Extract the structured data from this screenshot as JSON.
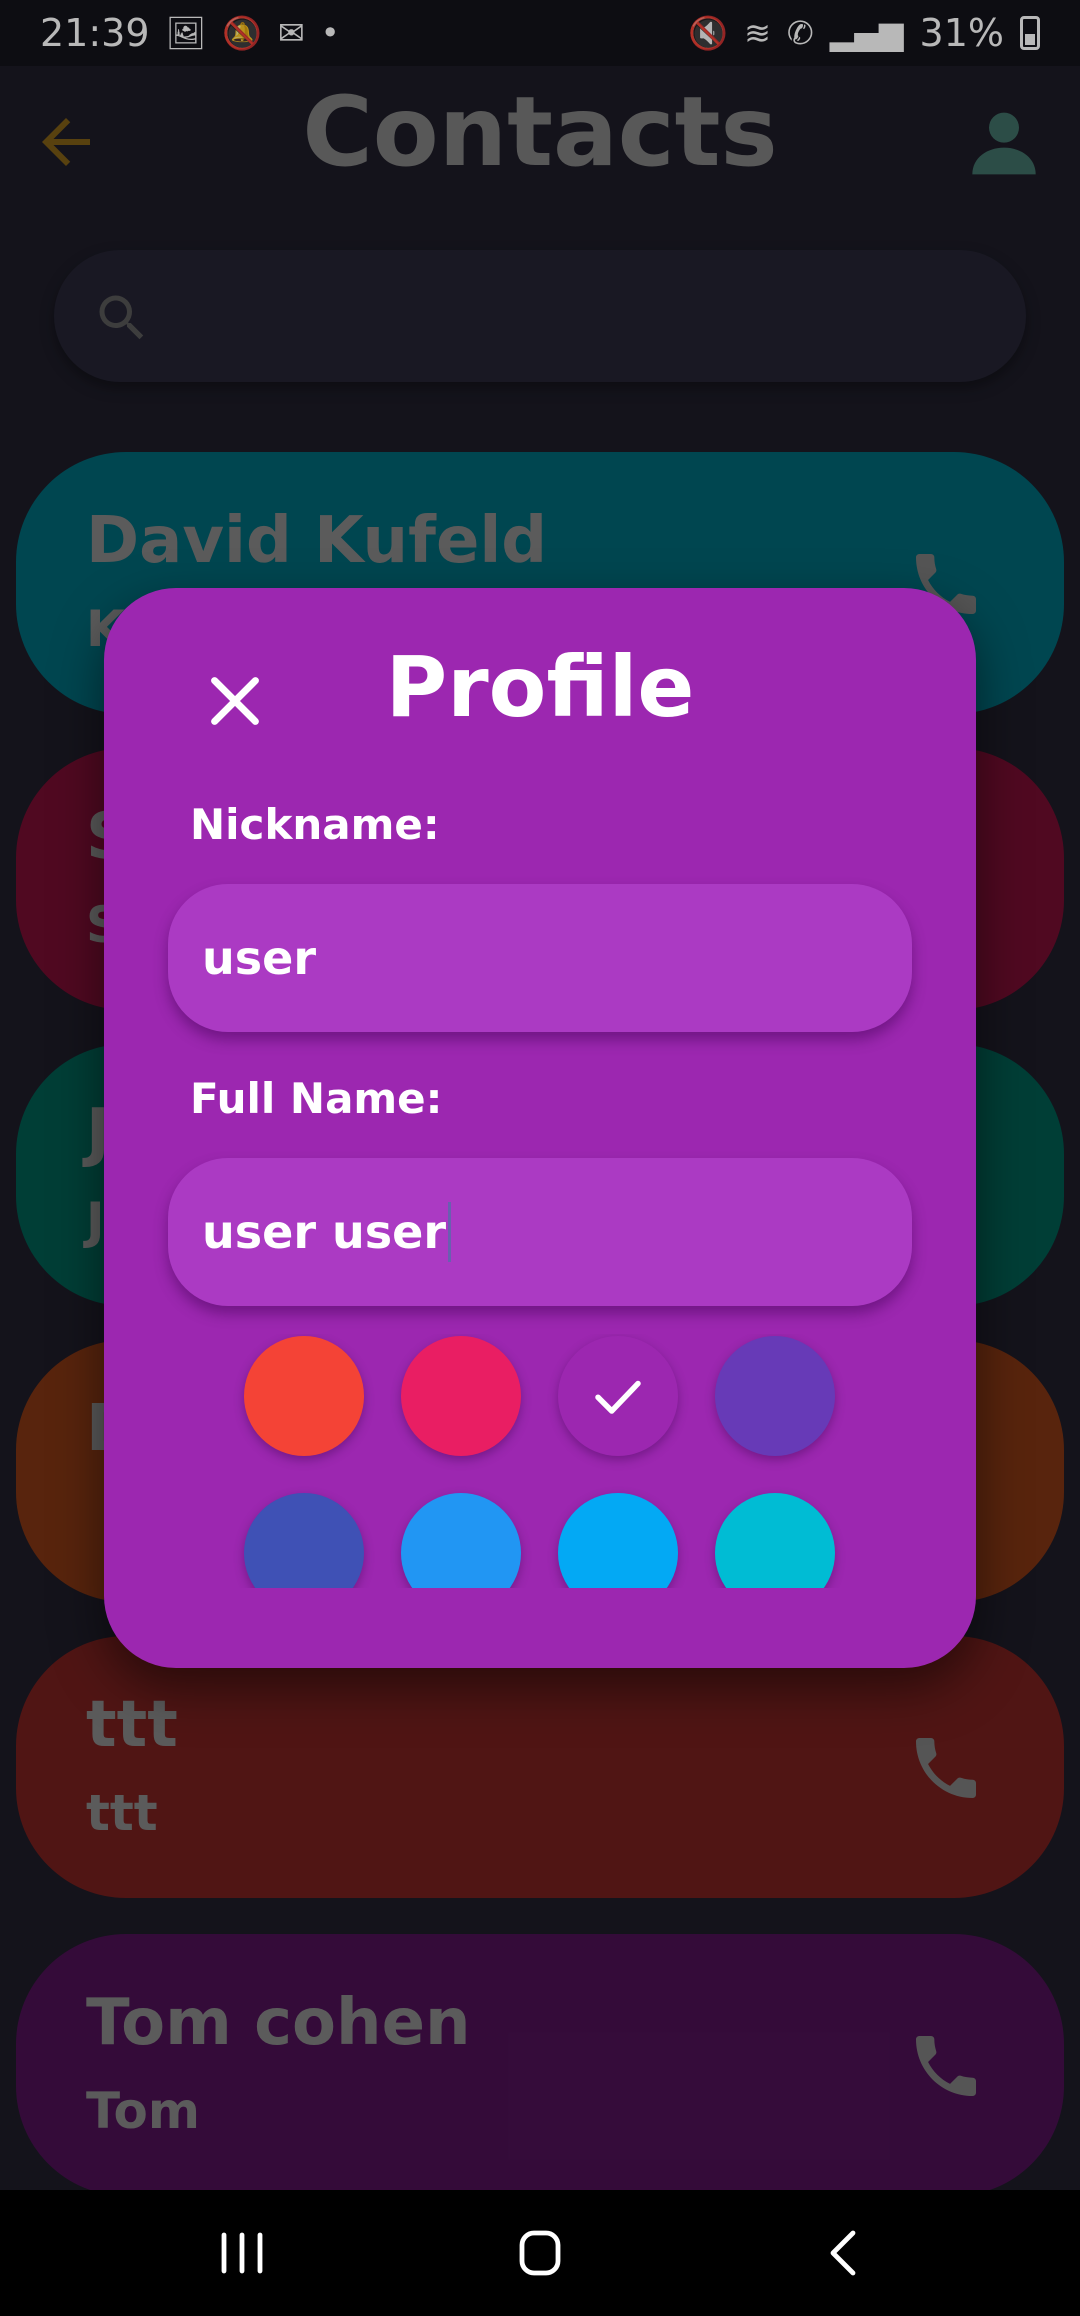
{
  "status": {
    "time": "21:39",
    "battery": "31%",
    "left_icons": [
      "image-icon",
      "notifications-off-icon",
      "gmail-icon",
      "dot-icon"
    ],
    "right_icons": [
      "mute-icon",
      "wifi-icon",
      "wifi-calling-icon",
      "signal-icon",
      "battery-icon"
    ]
  },
  "header": {
    "title": "Contacts"
  },
  "search": {
    "placeholder": ""
  },
  "contacts": [
    {
      "name": "David Kufeld",
      "sub": "K",
      "color": "#00626f"
    },
    {
      "name": "S",
      "sub": "S",
      "color": "#700d2f"
    },
    {
      "name": "J",
      "sub": "J",
      "color": "#00574c"
    },
    {
      "name": "D",
      "sub": "",
      "color": "#7b3213"
    },
    {
      "name": "ttt",
      "sub": "ttt",
      "color": "#701e1d"
    },
    {
      "name": "Tom cohen",
      "sub": "Tom",
      "color": "#491050"
    }
  ],
  "dialog": {
    "title": "Profile",
    "nickname_label": "Nickname:",
    "nickname_value": "user",
    "fullname_label": "Full Name:",
    "fullname_value": "user user",
    "colors": [
      "#f44336",
      "#e91e63",
      "#9c27b0",
      "#673ab7",
      "#3f51b5",
      "#2196f3",
      "#03a9f4",
      "#00bcd4"
    ],
    "selected_color": "#9c27b0"
  }
}
